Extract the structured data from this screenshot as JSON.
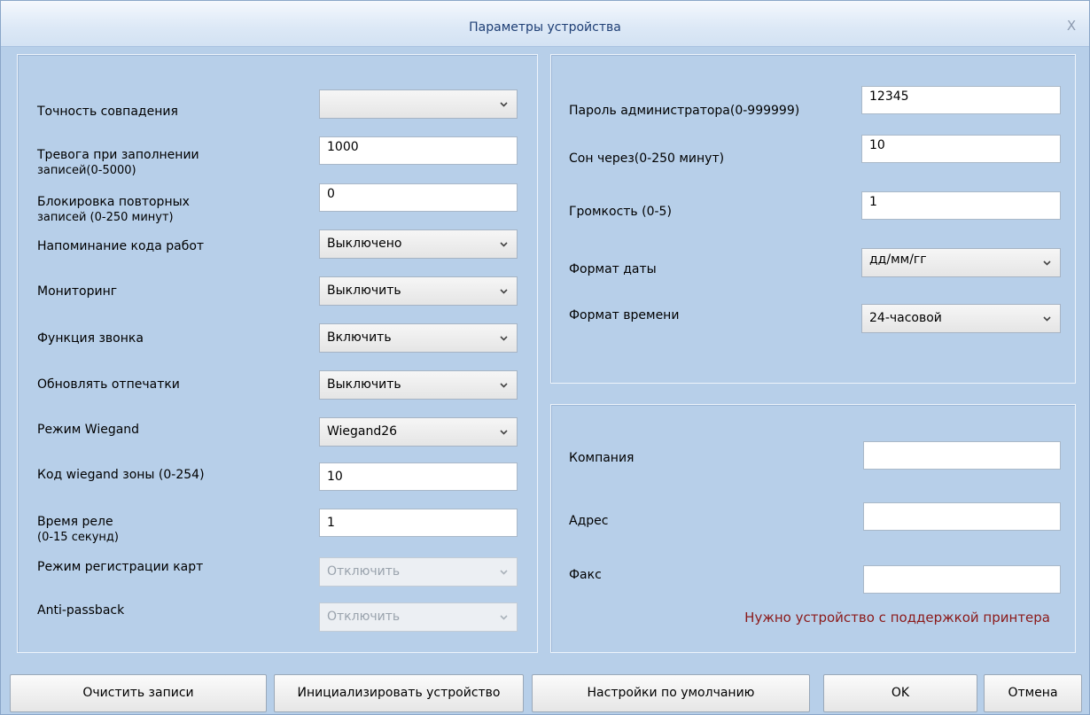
{
  "window": {
    "title": "Параметры устройства",
    "close_label": "X"
  },
  "left": {
    "match_accuracy": {
      "label": "Точность совпадения",
      "value": ""
    },
    "records_alarm": {
      "label1": "Тревога при заполнении",
      "label2": "записей(0-5000)",
      "value": "1000"
    },
    "repeat_block": {
      "label1": "Блокировка повторных",
      "label2": "записей (0-250 минут)",
      "value": "0"
    },
    "work_code_reminder": {
      "label": "Напоминание кода работ",
      "value": "Выключено"
    },
    "monitoring": {
      "label": "Мониторинг",
      "value": "Выключить"
    },
    "bell_function": {
      "label": "Функция звонка",
      "value": "Включить"
    },
    "update_fingerprints": {
      "label": "Обновлять отпечатки",
      "value": "Выключить"
    },
    "wiegand_mode": {
      "label": "Режим Wiegand",
      "value": "Wiegand26"
    },
    "wiegand_zone": {
      "label": "Код wiegand зоны (0-254)",
      "value": "10"
    },
    "relay_time": {
      "label1": "Время реле",
      "label2": "(0-15 секунд)",
      "value": "1"
    },
    "card_registration": {
      "label": "Режим регистрации карт",
      "value": "Отключить"
    },
    "anti_passback": {
      "label": "Anti-passback",
      "value": "Отключить"
    }
  },
  "right": {
    "admin_password": {
      "label": "Пароль администратора(0-999999)",
      "value": "12345"
    },
    "sleep_after": {
      "label": "Сон через(0-250 минут)",
      "value": "10"
    },
    "volume": {
      "label": "Громкость (0-5)",
      "value": "1"
    },
    "date_format": {
      "label": "Формат даты",
      "value": "дд/мм/гг"
    },
    "time_format": {
      "label": "Формат времени",
      "value": "24-часовой"
    },
    "company": {
      "label": "Компания",
      "value": ""
    },
    "address": {
      "label": "Адрес",
      "value": ""
    },
    "fax": {
      "label": "Факс",
      "value": ""
    },
    "printer_note": "Нужно устройство с поддержкой принтера"
  },
  "buttons": {
    "clear_records": "Очистить записи",
    "init_device": "Инициализировать устройство",
    "defaults": "Настройки по умолчанию",
    "ok": "OK",
    "cancel": "Отмена"
  },
  "colors": {
    "window_bg": "#b7cfe9",
    "title_text": "#1f3f75",
    "note_text": "#8b1a1a"
  }
}
